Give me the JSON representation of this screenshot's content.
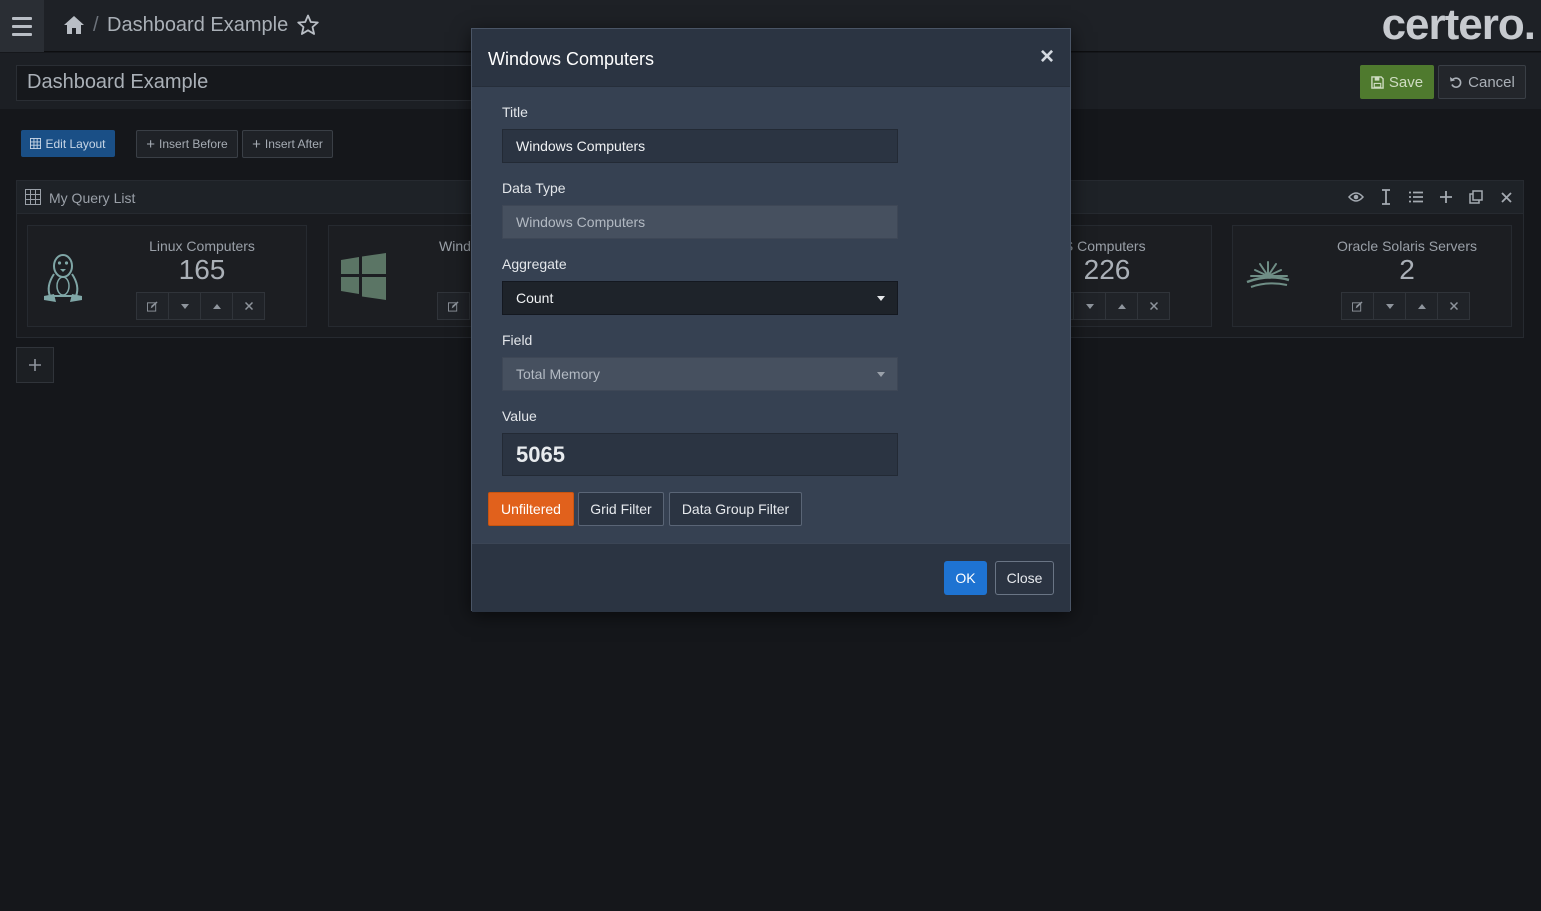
{
  "topbar": {
    "breadcrumb_separator": "/",
    "breadcrumb_title": "Dashboard Example",
    "logo_text": "certero."
  },
  "editbar": {
    "title_value": "Dashboard Example",
    "save_label": "Save",
    "cancel_label": "Cancel"
  },
  "layout_toolbar": {
    "edit_layout_label": "Edit Layout",
    "insert_before_label": "Insert Before",
    "insert_after_label": "Insert After"
  },
  "panel": {
    "title": "My Query List",
    "tools": [
      "eye-icon",
      "text-cursor-icon",
      "list-icon",
      "plus-icon",
      "copy-icon",
      "close-icon"
    ],
    "tiles": [
      {
        "title": "Linux Computers",
        "value": "165",
        "icon": "linux-penguin-icon"
      },
      {
        "title": "Wind",
        "value": "",
        "icon": "windows-logo-icon"
      },
      {
        "title": "OS Computers",
        "value": "226",
        "icon": ""
      },
      {
        "title": "Oracle Solaris Servers",
        "value": "2",
        "icon": "solaris-sun-icon"
      }
    ]
  },
  "modal": {
    "title": "Windows Computers",
    "fields": {
      "title_label": "Title",
      "title_value": "Windows Computers",
      "data_type_label": "Data Type",
      "data_type_value": "Windows Computers",
      "aggregate_label": "Aggregate",
      "aggregate_value": "Count",
      "field_label": "Field",
      "field_value": "Total Memory",
      "value_label": "Value",
      "value_value": "5065"
    },
    "filters": {
      "unfiltered_label": "Unfiltered",
      "grid_filter_label": "Grid Filter",
      "data_group_filter_label": "Data Group Filter",
      "active": "Unfiltered"
    },
    "footer": {
      "ok_label": "OK",
      "close_label": "Close"
    }
  },
  "colors": {
    "accent_orange": "#e1611c",
    "primary_blue": "#1e73d2",
    "save_green": "#4f7a2e"
  }
}
